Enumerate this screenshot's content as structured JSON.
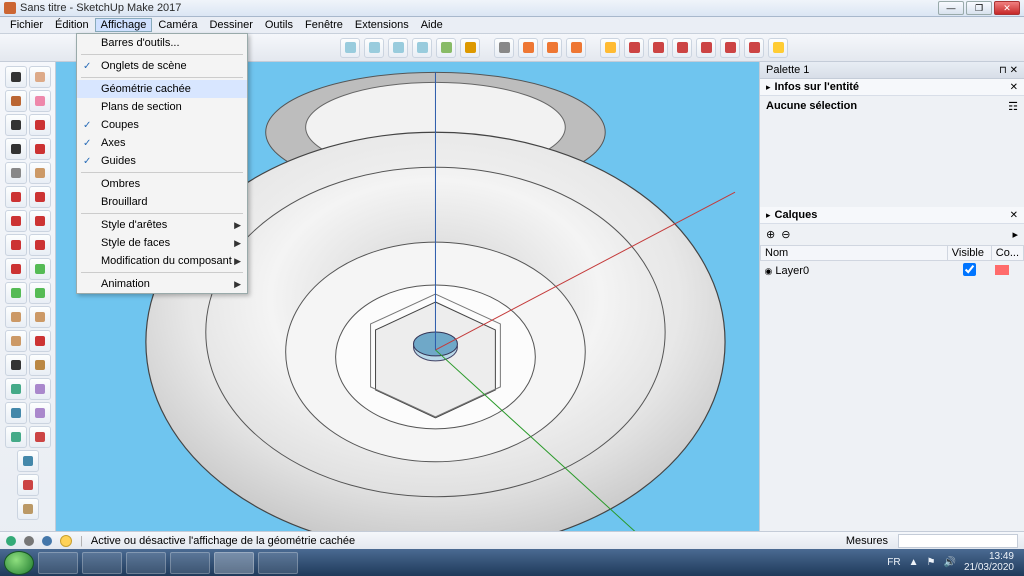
{
  "window": {
    "title": "Sans titre - SketchUp Make 2017"
  },
  "menu": {
    "items": [
      "Fichier",
      "Édition",
      "Affichage",
      "Caméra",
      "Dessiner",
      "Outils",
      "Fenêtre",
      "Extensions",
      "Aide"
    ],
    "active_index": 2
  },
  "dropdown": {
    "items": [
      {
        "label": "Barres d'outils...",
        "checked": false,
        "submenu": false
      },
      {
        "sep": true
      },
      {
        "label": "Onglets de scène",
        "checked": true,
        "submenu": false
      },
      {
        "sep": true
      },
      {
        "label": "Géométrie cachée",
        "checked": false,
        "submenu": false,
        "hover": true
      },
      {
        "label": "Plans de section",
        "checked": false,
        "submenu": false
      },
      {
        "label": "Coupes",
        "checked": true,
        "submenu": false
      },
      {
        "label": "Axes",
        "checked": true,
        "submenu": false
      },
      {
        "label": "Guides",
        "checked": true,
        "submenu": false
      },
      {
        "sep": true
      },
      {
        "label": "Ombres",
        "checked": false,
        "submenu": false
      },
      {
        "label": "Brouillard",
        "checked": false,
        "submenu": false
      },
      {
        "sep": true
      },
      {
        "label": "Style d'arêtes",
        "checked": false,
        "submenu": true
      },
      {
        "label": "Style de faces",
        "checked": false,
        "submenu": true
      },
      {
        "label": "Modification du composant",
        "checked": false,
        "submenu": true
      },
      {
        "sep": true
      },
      {
        "label": "Animation",
        "checked": false,
        "submenu": true
      }
    ]
  },
  "toolbar_top": {
    "icons": [
      "cube1",
      "cube2",
      "cube3",
      "cube4",
      "brush",
      "palette",
      "sel1",
      "sel2",
      "sel3",
      "warn",
      "move",
      "rot",
      "scale",
      "push",
      "follow",
      "offset",
      "sun",
      "gears"
    ]
  },
  "left_tools": {
    "rows": 19
  },
  "right_panel": {
    "palette_title": "Palette 1",
    "entity_header": "Infos sur l'entité",
    "entity_body": "Aucune sélection",
    "layers_header": "Calques",
    "layers_cols": {
      "name": "Nom",
      "visible": "Visible",
      "color": "Co..."
    },
    "layer0": "Layer0",
    "add_icon": "⊕",
    "remove_icon": "⊖",
    "menu_icon": "▸"
  },
  "status": {
    "hint": "Active ou désactive l'affichage de la géométrie cachée",
    "measures_label": "Mesures",
    "measures_value": ""
  },
  "tray": {
    "lang": "FR",
    "time": "13:49",
    "date": "21/03/2020"
  }
}
